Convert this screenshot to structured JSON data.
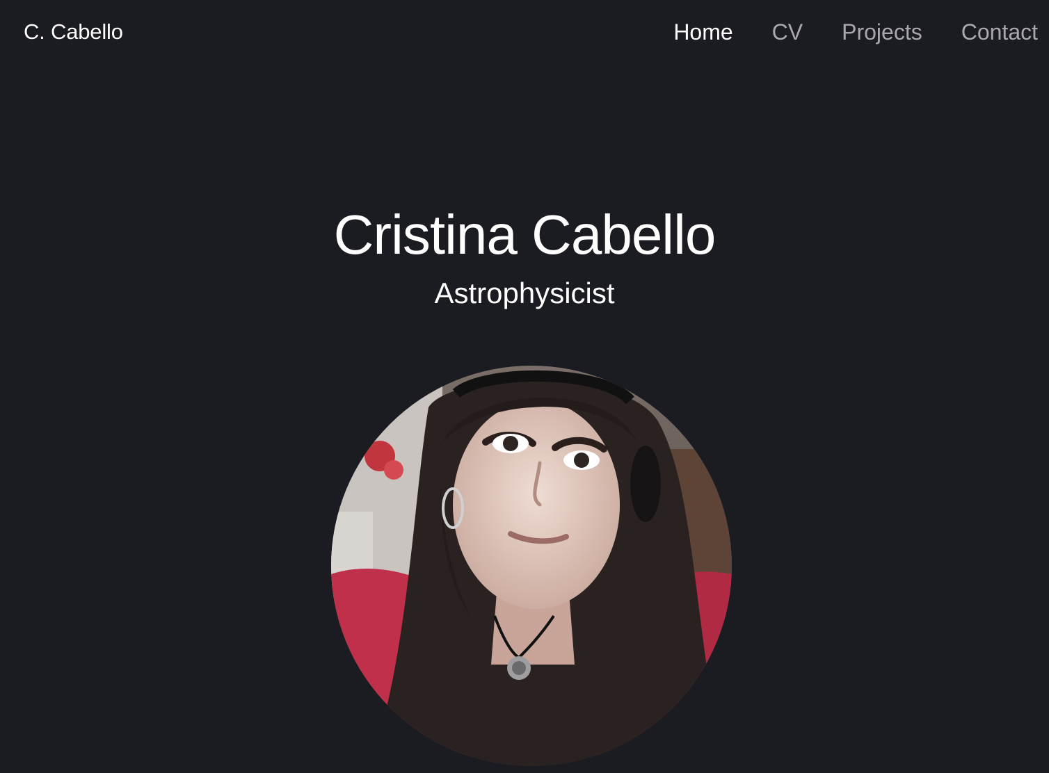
{
  "nav": {
    "brand": "C. Cabello",
    "links": [
      {
        "label": "Home",
        "active": true
      },
      {
        "label": "CV",
        "active": false
      },
      {
        "label": "Projects",
        "active": false
      },
      {
        "label": "Contact",
        "active": false
      }
    ]
  },
  "hero": {
    "name": "Cristina Cabello",
    "title": "Astrophysicist",
    "avatar_icon": "profile-photo"
  },
  "colors": {
    "background": "#1b1b22",
    "text": "#ffffff",
    "nav_inactive": "#a8a8ae"
  }
}
